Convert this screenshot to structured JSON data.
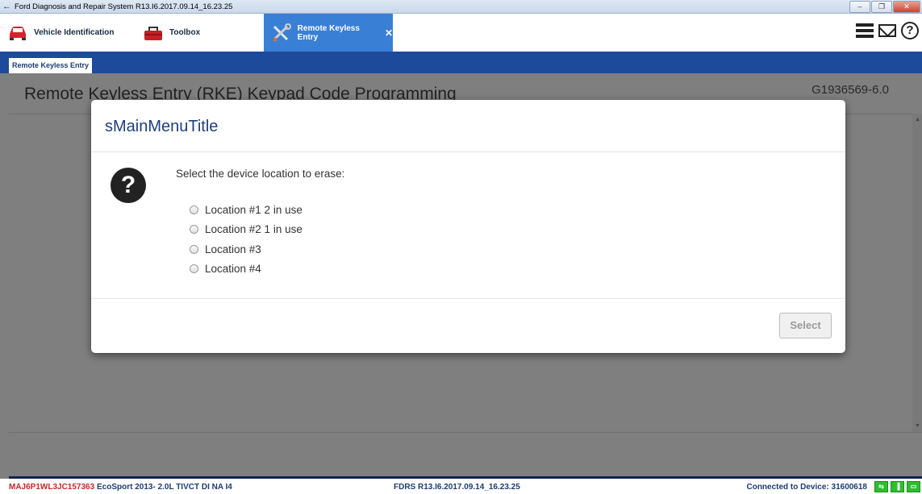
{
  "window": {
    "title": "Ford Diagnosis and Repair System R13.I6.2017.09.14_16.23.25",
    "controls": [
      "–",
      "❐",
      "✕"
    ]
  },
  "tabs": [
    {
      "label": "Vehicle Identification",
      "icon": "car-icon"
    },
    {
      "label": "Toolbox",
      "icon": "toolbox-icon"
    },
    {
      "label": "Remote Keyless Entry",
      "icon": "wrench-screwdriver-icon",
      "active": true,
      "close": "✕"
    }
  ],
  "header_icons": [
    "menu-icon",
    "mail-icon",
    "help-icon"
  ],
  "subnav": {
    "label": "Remote Keyless Entry"
  },
  "page": {
    "title": "Remote Keyless Entry (RKE) Keypad Code Programming",
    "code": "G1936569-6.0"
  },
  "dialog": {
    "title": "sMainMenuTitle",
    "prompt": "Select the device location to erase:",
    "options": [
      "Location #1 2 in use",
      "Location #2 1 in use",
      "Location #3",
      "Location #4"
    ],
    "button": "Select"
  },
  "status": {
    "vin": "MAJ6P1WL3JC157363",
    "vehicle": "EcoSport 2013- 2.0L TIVCT DI NA I4",
    "version": "FDRS R13.I6.2017.09.14_16.23.25",
    "connected": "Connected to Device: 31600618"
  },
  "colors": {
    "accent": "#1d4a9a",
    "active_tab": "#3a7fd6",
    "vin": "#c8262a",
    "status_ok": "#2fbd2f"
  }
}
